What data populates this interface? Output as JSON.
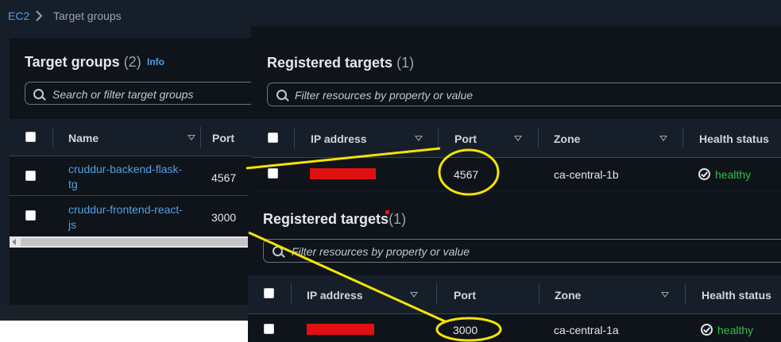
{
  "breadcrumb": {
    "root": "EC2",
    "current": "Target groups"
  },
  "colors": {
    "link": "#539fe5",
    "healthy": "#2fbf45",
    "redaction": "#e01010",
    "annotation": "#f4e400"
  },
  "left_panel": {
    "title": "Target groups",
    "count": "(2)",
    "info": "Info",
    "search_placeholder": "Search or filter target groups",
    "columns": [
      "Name",
      "Port"
    ],
    "rows": [
      {
        "name_line1": "cruddur-backend-flask-",
        "name_line2": "tg",
        "port": "4567"
      },
      {
        "name_line1": "cruddur-frontend-react-",
        "name_line2": "js",
        "port": "3000"
      }
    ]
  },
  "top_panel": {
    "title": "Registered targets",
    "count": "(1)",
    "search_placeholder": "Filter resources by property or value",
    "columns": [
      "IP address",
      "Port",
      "Zone",
      "Health status"
    ],
    "row": {
      "port": "4567",
      "zone": "ca-central-1b",
      "health": "healthy"
    }
  },
  "bottom_panel": {
    "title": "Registered targets",
    "count": "(1)",
    "search_placeholder": "Filter resources by property or value",
    "columns": [
      "IP address",
      "Port",
      "Zone",
      "Health status"
    ],
    "row": {
      "port": "3000",
      "zone": "ca-central-1a",
      "health": "healthy"
    }
  }
}
